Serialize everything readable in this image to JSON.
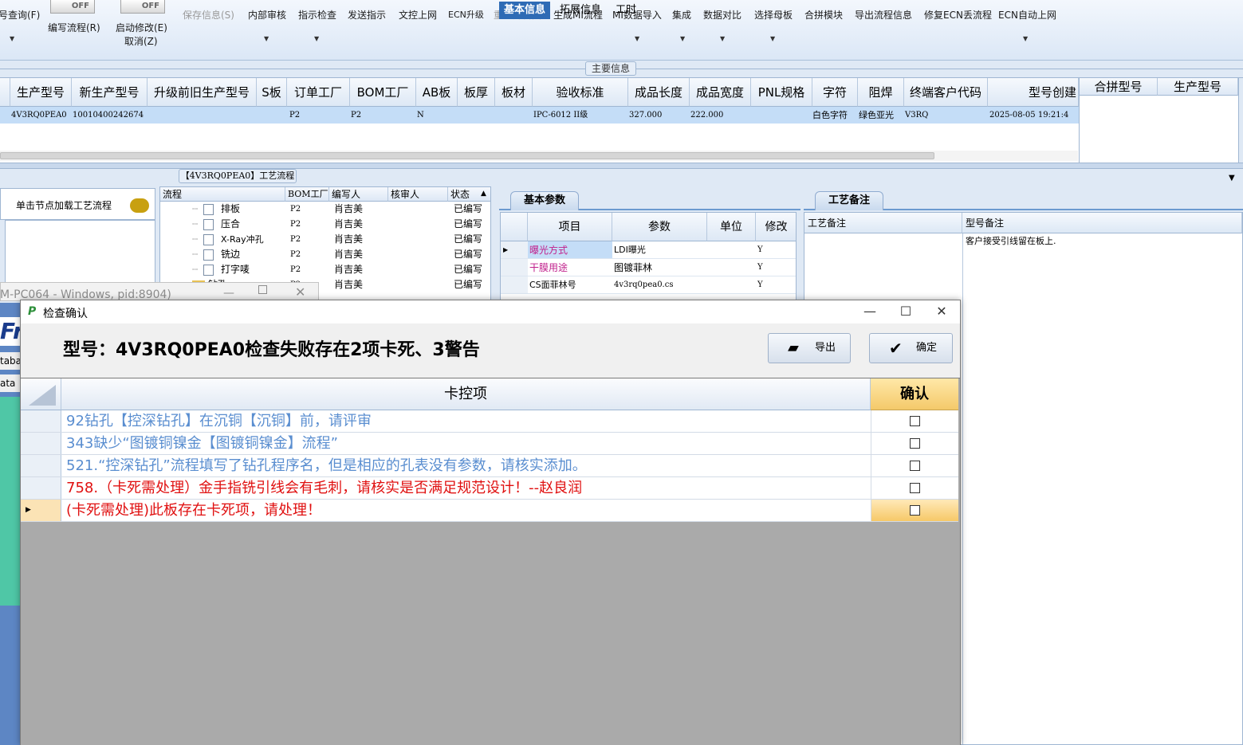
{
  "toolbar": {
    "items": [
      {
        "label": "号查询(F)",
        "dropdown": true,
        "disabled": false
      },
      {
        "label": "编写流程(R)",
        "toggle": "OFF"
      },
      {
        "label": "启动修改(E)",
        "label2": "取消(Z)",
        "toggle": "OFF"
      },
      {
        "label": "保存信息(S)",
        "disabled": true
      },
      {
        "label": "内部审核",
        "dropdown": true
      },
      {
        "label": "指示检查",
        "dropdown": true
      },
      {
        "label": "发送指示"
      },
      {
        "label": "文控上网"
      },
      {
        "label": "ECN升级"
      },
      {
        "label": "重选开料图",
        "disabled": true
      },
      {
        "label": "生成MI流程"
      },
      {
        "label": "MI数据导入",
        "dropdown": true
      },
      {
        "label": "集成",
        "dropdown": true
      },
      {
        "label": "数据对比",
        "dropdown": true
      },
      {
        "label": "选择母板",
        "dropdown": true
      },
      {
        "label": "合拼模块"
      },
      {
        "label": "导出流程信息"
      },
      {
        "label": "修复ECN丢流程"
      },
      {
        "label": "ECN自动上网",
        "dropdown": true
      }
    ]
  },
  "main_info": {
    "title": "主要信息"
  },
  "main_grid": {
    "columns": [
      "生产型号",
      "新生产型号",
      "升级前旧生产型号",
      "S板",
      "订单工厂",
      "BOM工厂",
      "AB板",
      "板厚",
      "板材",
      "验收标准",
      "成品长度",
      "成品宽度",
      "PNL规格",
      "字符",
      "阻焊",
      "终端客户代码",
      "型号创建"
    ],
    "row": {
      "生产型号": "4V3RQ0PEA0",
      "新生产型号": "10010400242674",
      "订单工厂": "P2",
      "BOM工厂": "P2",
      "AB板": "N",
      "验收标准": "IPC-6012 II级",
      "成品长度": "327.000",
      "成品宽度": "222.000",
      "字符": "白色字符",
      "阻焊": "绿色亚光",
      "终端客户代码": "V3RQ",
      "型号创建": "2025-08-05 19:21:4"
    }
  },
  "merge_grid": {
    "columns": [
      "合拼型号",
      "生产型号"
    ]
  },
  "left_panel": {
    "load_label": "单击节点加载工艺流程"
  },
  "process_flow": {
    "title": "【4V3RQ0PEA0】工艺流程",
    "columns": [
      "流程",
      "BOM工厂",
      "编写人",
      "核审人",
      "状态"
    ],
    "rows": [
      {
        "name": "排板",
        "factory": "P2",
        "writer": "肖吉美",
        "status": "已编写"
      },
      {
        "name": "压合",
        "factory": "P2",
        "writer": "肖吉美",
        "status": "已编写"
      },
      {
        "name": "X-Ray冲孔",
        "factory": "P2",
        "writer": "肖吉美",
        "status": "已编写"
      },
      {
        "name": "铣边",
        "factory": "P2",
        "writer": "肖吉美",
        "status": "已编写"
      },
      {
        "name": "打字唛",
        "factory": "P2",
        "writer": "肖吉美",
        "status": "已编写"
      },
      {
        "name": "钻孔",
        "factory": "P2",
        "writer": "肖吉美",
        "status": "已编写"
      }
    ]
  },
  "tabs": [
    "基本信息",
    "拓展信息",
    "工时"
  ],
  "basic_params": {
    "subtab": "基本参数",
    "columns": [
      "项目",
      "参数",
      "单位",
      "修改"
    ],
    "rows": [
      {
        "item": "曝光方式",
        "param": "LDI曝光",
        "unit": "",
        "mod": "Y"
      },
      {
        "item": "干膜用途",
        "param": "图镀菲林",
        "unit": "",
        "mod": "Y"
      },
      {
        "item": "CS面菲林号",
        "param": "4v3rq0pea0.cs",
        "unit": "",
        "mod": "Y"
      }
    ]
  },
  "remarks": {
    "subtab": "工艺备注",
    "columns": [
      "工艺备注",
      "型号备注"
    ],
    "model_remark": "客户接受引线留在板上."
  },
  "ghost_window": {
    "title": "M-PC064 - Windows, pid:8904)",
    "side_labels": [
      "Fr",
      "taba",
      "ata"
    ]
  },
  "dialog": {
    "title": "检查确认",
    "message": "型号：4V3RQ0PEA0检查失败存在2项卡死、3警告",
    "export_label": "导出",
    "ok_label": "确定",
    "grid_headers": [
      "卡控项",
      "确认"
    ],
    "rows": [
      {
        "text": "92钻孔【控深钻孔】在沉铜【沉铜】前，请评审",
        "level": "warning",
        "checked": false
      },
      {
        "text": "343缺少“图镀铜镍金【图镀铜镍金】流程”",
        "level": "warning",
        "checked": false
      },
      {
        "text": "521.“控深钻孔”流程填写了钻孔程序名，但是相应的孔表没有参数，请核实添加。",
        "level": "warning",
        "checked": false
      },
      {
        "text": "758.（卡死需处理）金手指铣引线会有毛刺，请核实是否满足规范设计！--赵良润",
        "level": "error",
        "checked": false
      },
      {
        "text": "(卡死需处理)此板存在卡死项，请处理！",
        "level": "error",
        "checked": false,
        "selected": true
      }
    ]
  },
  "colors": {
    "warning": "#5a8ed0",
    "error": "#e01010",
    "selected_tab": "#2e6bb5",
    "header_gold": "#f4c96a"
  }
}
